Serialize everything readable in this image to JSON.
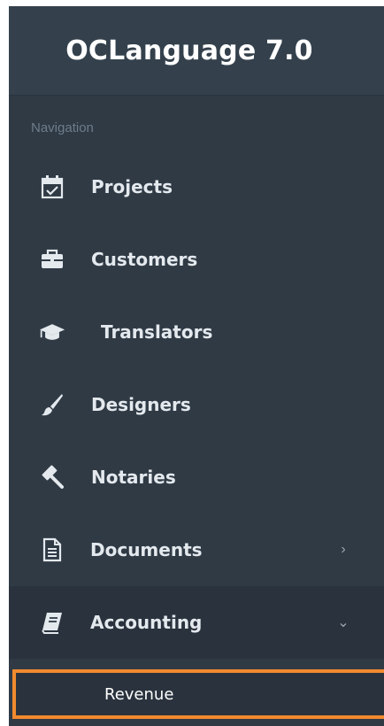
{
  "brand": {
    "title": "OCLanguage 7.0"
  },
  "navigation": {
    "heading": "Navigation",
    "items": [
      {
        "label": "Projects",
        "icon": "calendar-check-icon"
      },
      {
        "label": "Customers",
        "icon": "briefcase-icon"
      },
      {
        "label": "Translators",
        "icon": "graduation-cap-icon"
      },
      {
        "label": "Designers",
        "icon": "paint-brush-icon"
      },
      {
        "label": "Notaries",
        "icon": "gavel-icon"
      },
      {
        "label": "Documents",
        "icon": "file-text-icon",
        "chevron": "›"
      },
      {
        "label": "Accounting",
        "icon": "book-icon",
        "chevron": "⌄"
      }
    ],
    "submenu": [
      {
        "label": "Revenue",
        "highlighted": true
      }
    ]
  },
  "colors": {
    "sidebar_bg": "#2f3a45",
    "brand_bg": "#34414d",
    "active_bg": "#2a333d",
    "highlight_border": "#f28a2e",
    "text": "#e4e9ee",
    "muted": "#6e7d8b"
  }
}
